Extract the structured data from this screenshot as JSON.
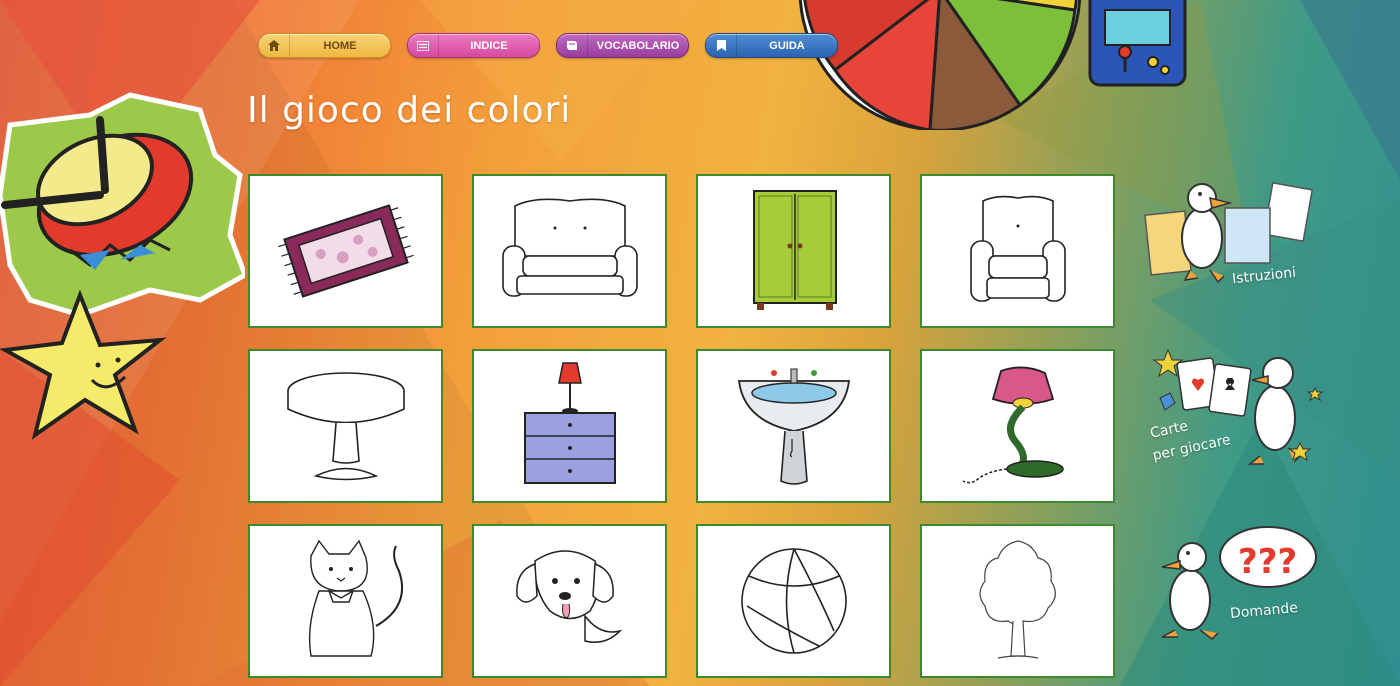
{
  "nav": [
    {
      "label": "HOME",
      "icon": "home-icon"
    },
    {
      "label": "INDICE",
      "icon": "index-icon"
    },
    {
      "label": "VOCABOLARIO",
      "icon": "book-icon"
    },
    {
      "label": "GUIDA",
      "icon": "bookmark-icon"
    }
  ],
  "title": "Il gioco dei colori",
  "cards": [
    {
      "name": "carpet"
    },
    {
      "name": "sofa"
    },
    {
      "name": "wardrobe"
    },
    {
      "name": "armchair"
    },
    {
      "name": "table"
    },
    {
      "name": "nightstand"
    },
    {
      "name": "sink"
    },
    {
      "name": "desk-lamp"
    },
    {
      "name": "cat"
    },
    {
      "name": "dog"
    },
    {
      "name": "ball"
    },
    {
      "name": "tree"
    }
  ],
  "sidebar": {
    "istruzioni": "Istruzioni",
    "carte_line1": "Carte",
    "carte_line2": "per giocare",
    "domande": "Domande"
  },
  "colors": {
    "card_border": "#3d8a2e",
    "home": "#efb840",
    "indice": "#d7489f",
    "vocabolario": "#993d9e",
    "guida": "#2c63b0"
  }
}
